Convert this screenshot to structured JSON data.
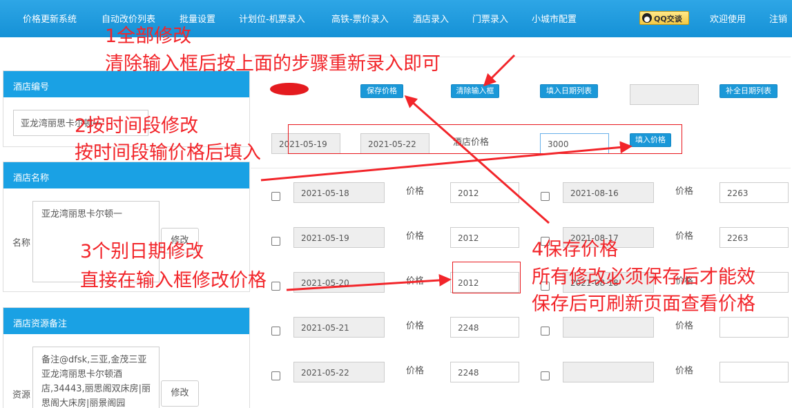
{
  "nav": {
    "items": [
      "价格更新系统",
      "自动改价列表",
      "批量设置",
      "计划位-机票录入",
      "高铁-票价录入",
      "酒店录入",
      "门票录入",
      "小城市配置"
    ],
    "qq": "QQ交谈",
    "welcome": "欢迎使用",
    "logout": "注销"
  },
  "left": {
    "hotel_code_title": "酒店编号",
    "hotel_code_value": "亚龙湾丽思卡尔顿一",
    "hotel_name_title": "酒店名称",
    "name_label": "名称",
    "hotel_name_value": "亚龙湾丽思卡尔顿一",
    "name_edit": "修改",
    "remark_title": "酒店资源备注",
    "remark_label": "资源",
    "remark_value": "备注@dfsk,三亚,金茂三亚亚龙湾丽思卡尔顿酒店,34443,丽思阁双床房|丽思阁大床房|丽景阁园",
    "remark_edit": "修改"
  },
  "toolbar": {
    "save": "保存价格",
    "clear": "清除输入框",
    "fill_dates": "填入日期列表",
    "complete_dates": "补全日期列表"
  },
  "range": {
    "start": "2021-05-19",
    "end": "2021-05-22",
    "label": "酒店价格",
    "price": "3000",
    "fill_price": "填入价格"
  },
  "price_label": "价格",
  "rows_left": [
    {
      "date": "2021-05-18",
      "price": "2012"
    },
    {
      "date": "2021-05-19",
      "price": "2012"
    },
    {
      "date": "2021-05-20",
      "price": "2012"
    },
    {
      "date": "2021-05-21",
      "price": "2248"
    },
    {
      "date": "2021-05-22",
      "price": "2248"
    }
  ],
  "rows_right": [
    {
      "date": "2021-08-16",
      "price": "2263"
    },
    {
      "date": "2021-08-17",
      "price": "2263"
    },
    {
      "date": "2021-08-18",
      "price": ""
    },
    {
      "date": "",
      "price": ""
    },
    {
      "date": "",
      "price": ""
    }
  ],
  "annotations": {
    "a1_line1": "1全部修改",
    "a1_line2": "清除输入框后按上面的步骤重新录入即可",
    "a2_line1": "2按时间段修改",
    "a2_line2": "按时间段输价格后填入",
    "a3_line1": "3个别日期修改",
    "a3_line2": "直接在输入框修改价格",
    "a4_line1": "4保存价格",
    "a4_line2": "所有修改必须保存后才能效",
    "a4_line3": "保存后可刷新页面查看价格"
  },
  "colors": {
    "nav": "#1591d6",
    "panel_head": "#1aa1e4",
    "annotation": "#f2252a"
  }
}
